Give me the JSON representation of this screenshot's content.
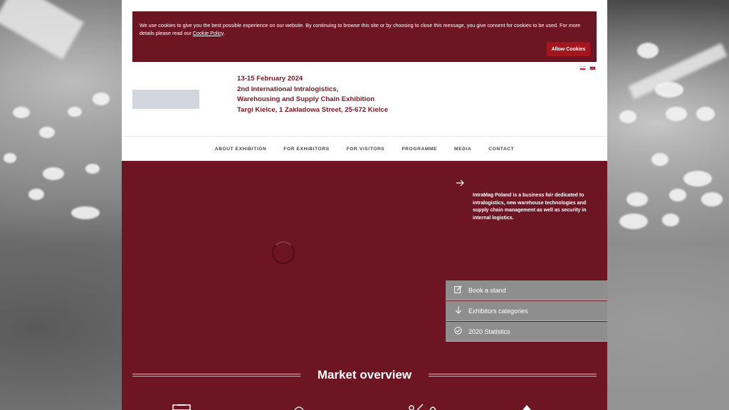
{
  "cookie": {
    "text": "We use cookies to give you the best possible experience on our website. By continuing to browse this site or by choosing to close this message, you give consent for cookies to be used. For more details please read our ",
    "link": "Cookie Policy",
    "suffix": ".",
    "button": "Allow Cookies"
  },
  "event": {
    "date": "13-15 February 2024",
    "line1": "2nd International Intralogistics,",
    "line2": "Warehousing and Supply Chain Exhibition",
    "venue": "Targi Kielce, 1 Zakładowa Street, 25-672 Kielce"
  },
  "nav": {
    "items": [
      "ABOUT EXHIBITION",
      "FOR EXHIBITORS",
      "FOR VISITORS",
      "PROGRAMME",
      "MEDIA",
      "CONTACT"
    ]
  },
  "hero": {
    "description": "IntraMag Poland is a business fair dedicated to intralogistics, new warehouse technologies and supply chain management as well as security in internal logistics.",
    "side_menu": [
      {
        "label": "Book a stand",
        "icon": "edit-icon"
      },
      {
        "label": "Exhibitors categories",
        "icon": "arrow-down-icon"
      },
      {
        "label": "2020 Statistics",
        "icon": "check-circle-icon"
      }
    ]
  },
  "market": {
    "title": "Market overview"
  },
  "colors": {
    "brand": "#6d1523",
    "button": "#a3161e",
    "side_menu": "#8e8e8e"
  }
}
